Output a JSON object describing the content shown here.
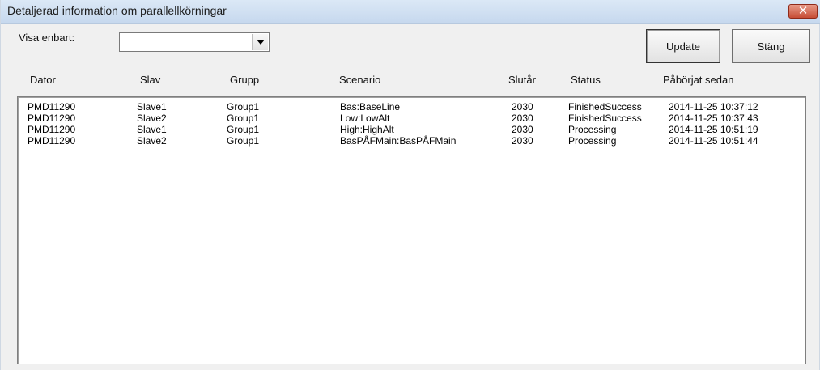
{
  "window": {
    "title": "Detaljerad information om parallellkörningar",
    "close_glyph": "✕"
  },
  "filter": {
    "label": "Visa enbart:",
    "selected_value": ""
  },
  "buttons": {
    "update": "Update",
    "close": "Stäng"
  },
  "columns": [
    "Dator",
    "Slav",
    "Grupp",
    "Scenario",
    "Slutår",
    "Status",
    "Påbörjat sedan"
  ],
  "rows": [
    [
      "PMD11290",
      "Slave1",
      "Group1",
      "Bas:BaseLine",
      "2030",
      "FinishedSuccess",
      "2014-11-25 10:37:12"
    ],
    [
      "PMD11290",
      "Slave2",
      "Group1",
      "Low:LowAlt",
      "2030",
      "FinishedSuccess",
      "2014-11-25 10:37:43"
    ],
    [
      "PMD11290",
      "Slave1",
      "Group1",
      "High:HighAlt",
      "2030",
      "Processing",
      "2014-11-25 10:51:19"
    ],
    [
      "PMD11290",
      "Slave2",
      "Group1",
      "BasPÅFMain:BasPÅFMain",
      "2030",
      "Processing",
      "2014-11-25 10:51:44"
    ]
  ]
}
